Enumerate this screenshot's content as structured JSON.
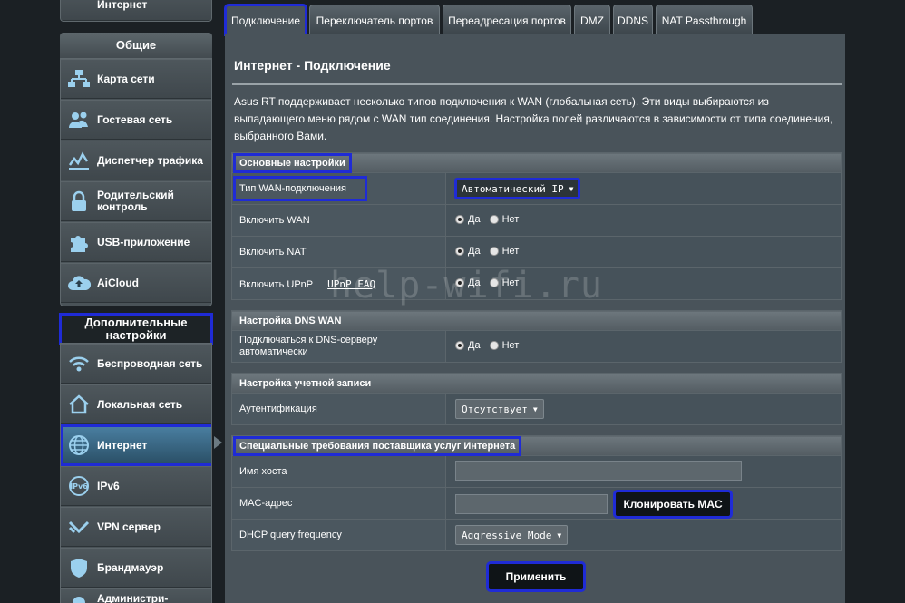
{
  "sidebar": {
    "top_item": "Интернет",
    "general_header": "Общие",
    "general_items": [
      {
        "label": "Карта сети",
        "icon": "network-map-icon"
      },
      {
        "label": "Гостевая сеть",
        "icon": "guest-network-icon"
      },
      {
        "label": "Диспетчер трафика",
        "icon": "traffic-manager-icon"
      },
      {
        "label": "Родительский контроль",
        "icon": "lock-icon"
      },
      {
        "label": "USB-приложение",
        "icon": "puzzle-icon"
      },
      {
        "label": "AiCloud",
        "icon": "cloud-icon"
      }
    ],
    "advanced_header": "Дополнительные настройки",
    "advanced_items": [
      {
        "label": "Беспроводная сеть",
        "icon": "wireless-icon"
      },
      {
        "label": "Локальная сеть",
        "icon": "home-icon"
      },
      {
        "label": "Интернет",
        "icon": "globe-icon"
      },
      {
        "label": "IPv6",
        "icon": "ipv6-icon"
      },
      {
        "label": "VPN сервер",
        "icon": "vpn-icon"
      },
      {
        "label": "Брандмауэр",
        "icon": "firewall-icon"
      },
      {
        "label": "Администри-",
        "icon": "admin-icon"
      }
    ]
  },
  "tabs": [
    "Подключение",
    "Переключатель портов",
    "Переадресация портов",
    "DMZ",
    "DDNS",
    "NAT Passthrough"
  ],
  "page": {
    "title": "Интернет - Подключение",
    "description": "Asus RT поддерживает несколько типов подключения к WAN (глобальная сеть). Эти виды выбираются из выпадающего меню рядом с WAN тип соединения. Настройка полей различаются в зависимости от типа соединения, выбранного Вами."
  },
  "basic": {
    "header": "Основные настройки",
    "wan_type_label": "Тип WAN-подключения",
    "wan_type_value": "Автоматический IP",
    "enable_wan_label": "Включить WAN",
    "enable_nat_label": "Включить NAT",
    "enable_upnp_label": "Включить UPnP",
    "upnp_faq": "UPnP FAQ",
    "yes": "Да",
    "no": "Нет"
  },
  "dns": {
    "header": "Настройка DNS WAN",
    "auto_dns_label": "Подключаться к DNS-серверу автоматически"
  },
  "account": {
    "header": "Настройка учетной записи",
    "auth_label": "Аутентификация",
    "auth_value": "Отсутствует"
  },
  "isp": {
    "header": "Специальные требования поставщика услуг Интернета",
    "hostname_label": "Имя хоста",
    "hostname_value": "",
    "mac_label": "MAC-адрес",
    "mac_value": "",
    "clone_mac_button": "Клонировать MAC",
    "dhcp_label": "DHCP query frequency",
    "dhcp_value": "Aggressive Mode"
  },
  "apply_button": "Применить",
  "watermark": "help-wifi.ru"
}
